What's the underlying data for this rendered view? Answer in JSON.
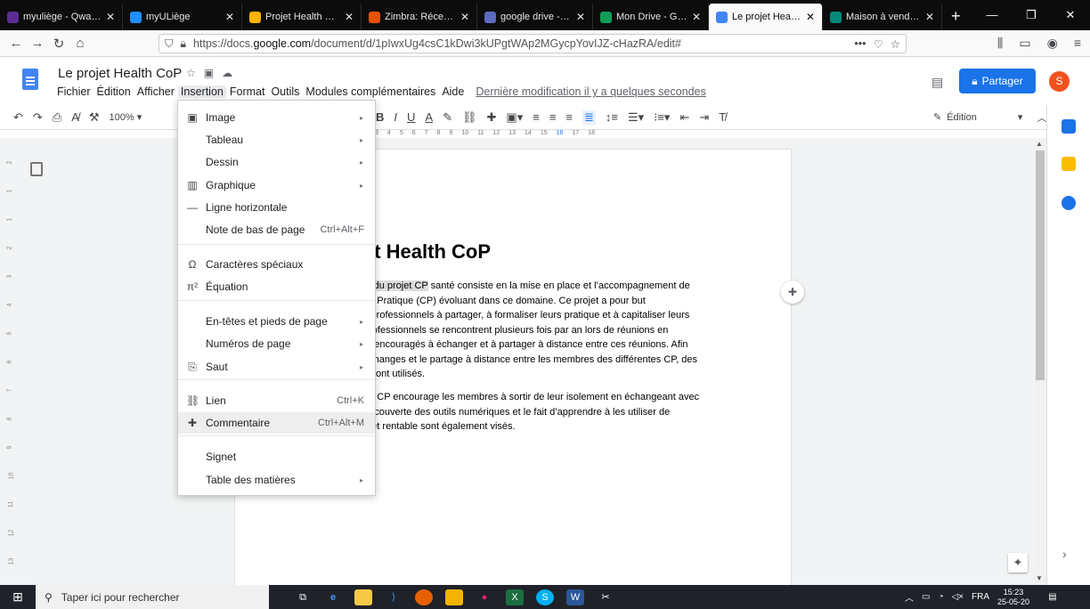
{
  "browser": {
    "tabs": [
      {
        "label": "myuliège - Qwant R",
        "color": "#5c2d91",
        "active": false
      },
      {
        "label": "myULiège",
        "color": "#1e90ff",
        "active": false
      },
      {
        "label": "Projet Health CoP",
        "color": "#ffb300",
        "active": false
      },
      {
        "label": "Zimbra: Réception",
        "color": "#e65100",
        "active": false
      },
      {
        "label": "google drive - Qwa",
        "color": "#5c6bc0",
        "active": false
      },
      {
        "label": "Mon Drive - Google",
        "color": "#0f9d58",
        "active": false
      },
      {
        "label": "Le projet Health Co",
        "color": "#4285f4",
        "active": true
      },
      {
        "label": "Maison à vendre - ",
        "color": "#00897b",
        "active": false
      }
    ],
    "new_tab": "+",
    "url_prefix": "https://docs.",
    "url_host": "google.com",
    "url_path": "/document/d/1pIwxUg4csC1kDwi3kUPgtWAp2MGycpYovIJZ-cHazRA/edit#",
    "url_more": "•••"
  },
  "docs": {
    "title": "Le projet Health CoP",
    "menu": [
      "Fichier",
      "Édition",
      "Afficher",
      "Insertion",
      "Format",
      "Outils",
      "Modules complémentaires",
      "Aide"
    ],
    "last_edit": "Dernière modification il y a quelques secondes",
    "share_label": "Partager",
    "avatar_letter": "S",
    "zoom": "100%",
    "edition_label": "Édition",
    "ruler_marks": [
      "3",
      "4",
      "5",
      "6",
      "7",
      "8",
      "9",
      "10",
      "11",
      "12",
      "13",
      "14",
      "15",
      "16",
      "17",
      "18"
    ],
    "vruler_marks": [
      "2",
      "1",
      "1",
      "2",
      "3",
      "4",
      "5",
      "6",
      "7",
      "8",
      "9",
      "10",
      "11",
      "12",
      "13"
    ]
  },
  "insert_menu": {
    "items": [
      {
        "label": "Image",
        "icon": "image-icon",
        "glyph": "▣",
        "shortcut": "",
        "submenu": true
      },
      {
        "label": "Tableau",
        "icon": "",
        "glyph": "",
        "shortcut": "",
        "submenu": true
      },
      {
        "label": "Dessin",
        "icon": "",
        "glyph": "",
        "shortcut": "",
        "submenu": true
      },
      {
        "label": "Graphique",
        "icon": "chart-icon",
        "glyph": "▥",
        "shortcut": "",
        "submenu": true
      },
      {
        "label": "Ligne horizontale",
        "icon": "horizontal-line-icon",
        "glyph": "—",
        "shortcut": "",
        "submenu": false
      },
      {
        "label": "Note de bas de page",
        "icon": "",
        "glyph": "",
        "shortcut": "Ctrl+Alt+F",
        "submenu": false
      },
      {
        "label": "Caractères spéciaux",
        "icon": "omega-icon",
        "glyph": "Ω",
        "shortcut": "",
        "submenu": false
      },
      {
        "label": "Équation",
        "icon": "pi-icon",
        "glyph": "π²",
        "shortcut": "",
        "submenu": false
      },
      {
        "label": "En-têtes et pieds de page",
        "icon": "",
        "glyph": "",
        "shortcut": "",
        "submenu": true
      },
      {
        "label": "Numéros de page",
        "icon": "",
        "glyph": "",
        "shortcut": "",
        "submenu": true
      },
      {
        "label": "Saut",
        "icon": "page-break-icon",
        "glyph": "⎘",
        "shortcut": "",
        "submenu": true
      },
      {
        "label": "Lien",
        "icon": "link-icon",
        "glyph": "⛓",
        "shortcut": "Ctrl+K",
        "submenu": false
      },
      {
        "label": "Commentaire",
        "icon": "comment-add-icon",
        "glyph": "✚",
        "shortcut": "Ctrl+Alt+M",
        "submenu": false
      },
      {
        "label": "Signet",
        "icon": "",
        "glyph": "",
        "shortcut": "",
        "submenu": false
      },
      {
        "label": "Table des matières",
        "icon": "",
        "glyph": "",
        "shortcut": "",
        "submenu": true
      }
    ]
  },
  "document": {
    "heading": "et Health CoP",
    "para1_highlight": "al du projet CP",
    "para1_lines": [
      " santé consiste en la mise en place et l’accompagnement de",
      "de Pratique (CP) évoluant dans ce domaine. Ce projet a pour but",
      "s professionnels à partager, à formaliser leurs pratique et à capitaliser leurs",
      "professionnels se rencontrent plusieurs fois par an lors de réunions en",
      "nt encouragés à échanger et à partager à distance entre ces réunions. Afin",
      "échanges et le partage à distance entre les membres des différentes CP, des",
      "s sont utilisés."
    ],
    "para2_lines": [
      "en CP encourage les membres à sortir de leur isolement en échangeant avec",
      "découverte des outils numériques et le fait d’apprendre à les utiliser de",
      "e et rentable sont également visés."
    ]
  },
  "taskbar": {
    "search_placeholder": "Taper ici pour rechercher",
    "lang": "FRA",
    "time": "15:23",
    "date": "25-05-20"
  }
}
